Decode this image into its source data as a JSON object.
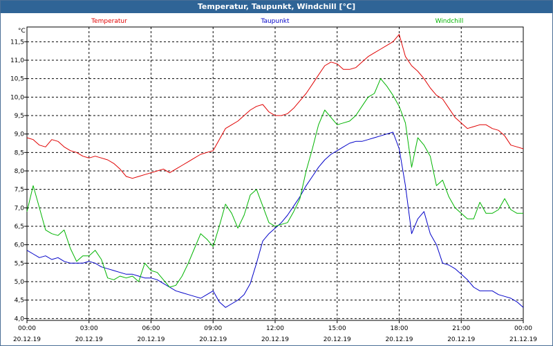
{
  "window": {
    "title": "Temperatur, Taupunkt, Windchill [°C]"
  },
  "colors": {
    "title_bar": "#2f6496",
    "grid": "#000000",
    "temperatur": "#e00000",
    "taupunkt": "#0000c8",
    "windchill": "#00b400"
  },
  "chart_data": {
    "type": "line",
    "title": "Temperatur, Taupunkt, Windchill [°C]",
    "unit_label": "°C",
    "ylim": [
      3.95,
      11.9
    ],
    "xlim": [
      0,
      24
    ],
    "grid": "dashed",
    "legend": "top",
    "y_ticks": [
      "4,0",
      "4,5",
      "5,0",
      "5,5",
      "6,0",
      "6,5",
      "7,0",
      "7,5",
      "8,0",
      "8,5",
      "9,0",
      "9,5",
      "10,0",
      "10,5",
      "11,0",
      "11,5"
    ],
    "x_ticks": [
      {
        "time": "00:00",
        "date": "20.12.19"
      },
      {
        "time": "03:00",
        "date": "20.12.19"
      },
      {
        "time": "06:00",
        "date": "20.12.19"
      },
      {
        "time": "09:00",
        "date": "20.12.19"
      },
      {
        "time": "12:00",
        "date": "20.12.19"
      },
      {
        "time": "15:00",
        "date": "20.12.19"
      },
      {
        "time": "18:00",
        "date": "20.12.19"
      },
      {
        "time": "21:00",
        "date": "20.12.19"
      },
      {
        "time": "00:00",
        "date": "21.12.19"
      }
    ],
    "series": [
      {
        "name": "Temperatur",
        "color": "#e00000",
        "x": [
          0,
          0.3,
          0.6,
          0.9,
          1.2,
          1.5,
          1.8,
          2.1,
          2.4,
          2.7,
          3.0,
          3.3,
          3.6,
          3.9,
          4.2,
          4.5,
          4.8,
          5.1,
          5.4,
          5.7,
          6.0,
          6.3,
          6.6,
          6.9,
          7.2,
          7.5,
          7.8,
          8.1,
          8.4,
          8.7,
          9.0,
          9.3,
          9.6,
          9.9,
          10.2,
          10.5,
          10.8,
          11.1,
          11.4,
          11.7,
          12.0,
          12.3,
          12.6,
          12.9,
          13.2,
          13.5,
          13.8,
          14.1,
          14.4,
          14.7,
          15.0,
          15.3,
          15.6,
          15.9,
          16.2,
          16.5,
          16.8,
          17.1,
          17.4,
          17.7,
          18.0,
          18.3,
          18.6,
          18.9,
          19.2,
          19.5,
          19.8,
          20.1,
          20.4,
          20.7,
          21.0,
          21.3,
          21.6,
          21.9,
          22.2,
          22.5,
          22.8,
          23.1,
          23.4,
          23.7,
          24.0
        ],
        "values": [
          8.9,
          8.85,
          8.7,
          8.65,
          8.85,
          8.8,
          8.65,
          8.55,
          8.5,
          8.4,
          8.35,
          8.4,
          8.35,
          8.3,
          8.2,
          8.05,
          7.85,
          7.8,
          7.85,
          7.9,
          7.95,
          8.0,
          8.05,
          7.95,
          8.05,
          8.15,
          8.25,
          8.35,
          8.45,
          8.5,
          8.55,
          8.85,
          9.15,
          9.25,
          9.35,
          9.5,
          9.65,
          9.75,
          9.8,
          9.6,
          9.5,
          9.5,
          9.55,
          9.7,
          9.9,
          10.1,
          10.35,
          10.6,
          10.85,
          10.95,
          10.9,
          10.75,
          10.75,
          10.8,
          10.95,
          11.1,
          11.2,
          11.3,
          11.4,
          11.5,
          11.7,
          11.1,
          10.85,
          10.7,
          10.5,
          10.25,
          10.05,
          9.95,
          9.7,
          9.45,
          9.3,
          9.15,
          9.2,
          9.25,
          9.25,
          9.15,
          9.1,
          8.95,
          8.7,
          8.65,
          8.6
        ]
      },
      {
        "name": "Taupunkt",
        "color": "#0000c8",
        "x": [
          0,
          0.3,
          0.6,
          0.9,
          1.2,
          1.5,
          1.8,
          2.1,
          2.4,
          2.7,
          3.0,
          3.3,
          3.6,
          3.9,
          4.2,
          4.5,
          4.8,
          5.1,
          5.4,
          5.7,
          6.0,
          6.3,
          6.6,
          6.9,
          7.2,
          7.5,
          7.8,
          8.1,
          8.4,
          8.7,
          9.0,
          9.3,
          9.6,
          9.9,
          10.2,
          10.5,
          10.8,
          11.1,
          11.4,
          11.7,
          12.0,
          12.3,
          12.6,
          12.9,
          13.2,
          13.5,
          13.8,
          14.1,
          14.4,
          14.7,
          15.0,
          15.3,
          15.6,
          15.9,
          16.2,
          16.5,
          16.8,
          17.1,
          17.4,
          17.7,
          18.0,
          18.3,
          18.6,
          18.9,
          19.2,
          19.5,
          19.8,
          20.1,
          20.4,
          20.7,
          21.0,
          21.3,
          21.6,
          21.9,
          22.2,
          22.5,
          22.8,
          23.1,
          23.4,
          23.7,
          24.0
        ],
        "values": [
          5.85,
          5.75,
          5.65,
          5.7,
          5.6,
          5.65,
          5.55,
          5.5,
          5.5,
          5.5,
          5.55,
          5.5,
          5.4,
          5.35,
          5.3,
          5.25,
          5.2,
          5.2,
          5.15,
          5.1,
          5.1,
          5.05,
          4.95,
          4.85,
          4.75,
          4.7,
          4.65,
          4.6,
          4.55,
          4.65,
          4.75,
          4.45,
          4.3,
          4.4,
          4.5,
          4.65,
          4.95,
          5.5,
          6.1,
          6.3,
          6.45,
          6.6,
          6.8,
          7.05,
          7.3,
          7.6,
          7.85,
          8.1,
          8.3,
          8.45,
          8.55,
          8.65,
          8.75,
          8.8,
          8.8,
          8.85,
          8.9,
          8.95,
          9.0,
          9.05,
          8.6,
          7.6,
          6.3,
          6.7,
          6.9,
          6.3,
          6.0,
          5.5,
          5.45,
          5.35,
          5.2,
          5.05,
          4.85,
          4.75,
          4.75,
          4.75,
          4.65,
          4.6,
          4.55,
          4.45,
          4.3
        ]
      },
      {
        "name": "Windchill",
        "color": "#00b400",
        "x": [
          0,
          0.3,
          0.6,
          0.9,
          1.2,
          1.5,
          1.8,
          2.1,
          2.4,
          2.7,
          3.0,
          3.3,
          3.6,
          3.9,
          4.2,
          4.5,
          4.8,
          5.1,
          5.4,
          5.7,
          6.0,
          6.3,
          6.6,
          6.9,
          7.2,
          7.5,
          7.8,
          8.1,
          8.4,
          8.7,
          9.0,
          9.3,
          9.6,
          9.9,
          10.2,
          10.5,
          10.8,
          11.1,
          11.4,
          11.7,
          12.0,
          12.3,
          12.6,
          12.9,
          13.2,
          13.5,
          13.8,
          14.1,
          14.4,
          14.7,
          15.0,
          15.3,
          15.6,
          15.9,
          16.2,
          16.5,
          16.8,
          17.1,
          17.4,
          17.7,
          18.0,
          18.3,
          18.6,
          18.9,
          19.2,
          19.5,
          19.8,
          20.1,
          20.4,
          20.7,
          21.0,
          21.3,
          21.6,
          21.9,
          22.2,
          22.5,
          22.8,
          23.1,
          23.4,
          23.7,
          24.0
        ],
        "values": [
          6.9,
          7.6,
          7.0,
          6.4,
          6.3,
          6.25,
          6.4,
          5.9,
          5.55,
          5.7,
          5.7,
          5.85,
          5.6,
          5.1,
          5.05,
          5.15,
          5.1,
          5.15,
          5.0,
          5.5,
          5.3,
          5.25,
          5.05,
          4.85,
          4.9,
          5.15,
          5.5,
          5.9,
          6.3,
          6.15,
          5.95,
          6.5,
          7.1,
          6.85,
          6.45,
          6.8,
          7.35,
          7.5,
          7.05,
          6.6,
          6.5,
          6.55,
          6.6,
          6.9,
          7.25,
          8.0,
          8.6,
          9.25,
          9.65,
          9.45,
          9.25,
          9.3,
          9.35,
          9.5,
          9.75,
          10.0,
          10.1,
          10.5,
          10.3,
          10.05,
          9.75,
          9.3,
          8.1,
          8.9,
          8.7,
          8.4,
          7.6,
          7.75,
          7.3,
          7.0,
          6.85,
          6.7,
          6.7,
          7.15,
          6.85,
          6.85,
          6.95,
          7.25,
          6.95,
          6.85,
          6.85
        ]
      }
    ]
  }
}
